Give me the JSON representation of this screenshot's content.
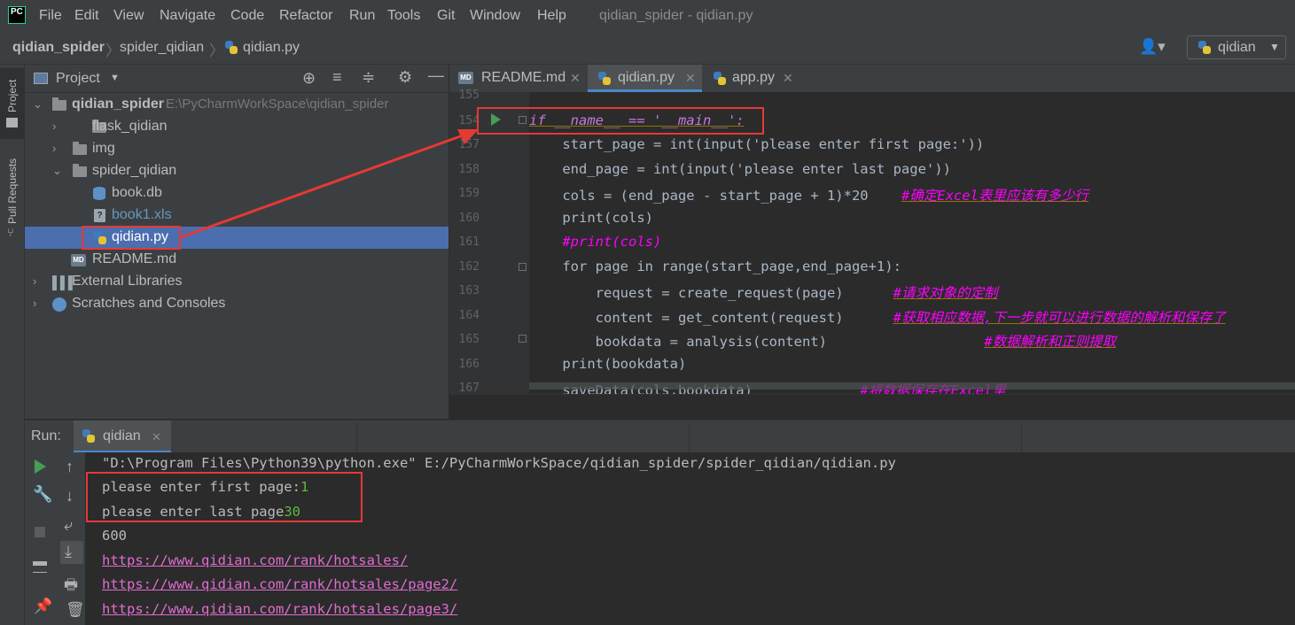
{
  "app": {
    "logo_text": "PC",
    "window_title": "qidian_spider - qidian.py",
    "menu": [
      "File",
      "Edit",
      "View",
      "Navigate",
      "Code",
      "Refactor",
      "Run",
      "Tools",
      "Git",
      "Window",
      "Help"
    ]
  },
  "breadcrumb": [
    "qidian_spider",
    "spider_qidian",
    "qidian.py"
  ],
  "run_config": {
    "label": "qidian"
  },
  "left_stripe": {
    "project_label": "Project",
    "pull_requests_label": "Pull Requests"
  },
  "project_panel": {
    "title": "Project",
    "tree": [
      {
        "label": "qidian_spider",
        "path": "E:\\PyCharmWorkSpace\\qidian_spider"
      },
      {
        "label": "flask_qidian"
      },
      {
        "label": "img"
      },
      {
        "label": "spider_qidian"
      },
      {
        "label": "book.db"
      },
      {
        "label": "book1.xls"
      },
      {
        "label": "qidian.py"
      },
      {
        "label": "README.md"
      },
      {
        "label": "External Libraries"
      },
      {
        "label": "Scratches and Consoles"
      }
    ]
  },
  "editor": {
    "tabs": [
      {
        "label": "README.md",
        "icon": "markdown-icon"
      },
      {
        "label": "qidian.py",
        "icon": "python-icon"
      },
      {
        "label": "app.py",
        "icon": "python-icon"
      }
    ],
    "line_numbers": [
      "155",
      "154",
      "157",
      "158",
      "159",
      "160",
      "161",
      "162",
      "163",
      "164",
      "165",
      "166",
      "167"
    ],
    "code": {
      "l154": "if __name__ == '__main__':",
      "l157": "    start_page = int(input('please enter first page:'))",
      "l158": "    end_page = int(input('please enter last page'))",
      "l159_code": "    cols = (end_page - start_page + 1)*20    ",
      "l159_cmt": "#确定Excel表里应该有多少行",
      "l160": "    print(cols)",
      "l161": "    #print(cols)",
      "l162": "    for page in range(start_page,end_page+1):",
      "l163_code": "        request = create_request(page)      ",
      "l163_cmt": "#请求对象的定制",
      "l164_code": "        content = get_content(request)      ",
      "l164_cmt": "#获取相应数据,下一步就可以进行数据的解析和保存了",
      "l165_code": "        bookdata = analysis(content)                   ",
      "l165_cmt": "#数据解析和正则提取",
      "l166": "    print(bookdata)",
      "l167_code": "    saveData(cols,bookdata)             ",
      "l167_cmt": "#将数据保存在Excel里"
    }
  },
  "run_panel": {
    "label": "Run:",
    "tab": "qidian",
    "console": {
      "cmd": "\"D:\\Program Files\\Python39\\python.exe\" E:/PyCharmWorkSpace/qidian_spider/spider_qidian/qidian.py",
      "prompt1": "please enter first page:",
      "input1": "1",
      "prompt2": "please enter last page",
      "input2": "30",
      "out1": "600",
      "link1": "https://www.qidian.com/rank/hotsales/",
      "link2": "https://www.qidian.com/rank/hotsales/page2/",
      "link3": "https://www.qidian.com/rank/hotsales/page3/"
    }
  },
  "colors": {
    "accent": "#e53935",
    "selection": "#4b6eaf",
    "run_green": "#499c54"
  }
}
